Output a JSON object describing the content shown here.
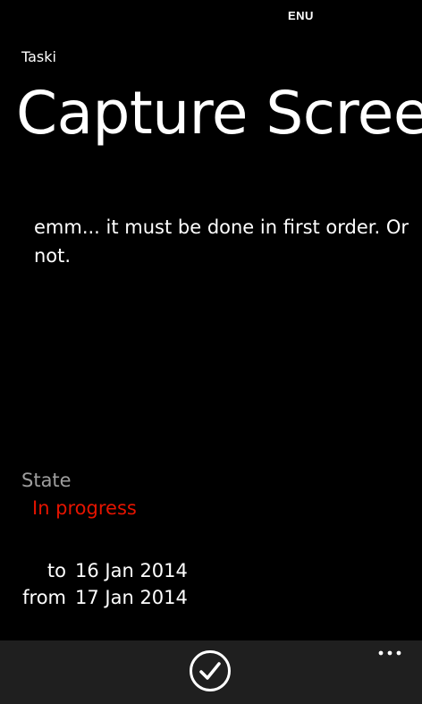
{
  "status_bar": {
    "language": "ENU"
  },
  "app": {
    "name": "Taski"
  },
  "task": {
    "title": "Capture Screen",
    "description": "emm... it must be done in first order. Or not.",
    "state_label": "State",
    "state_value": "In progress",
    "dates": {
      "to_label": "to",
      "to_value": "16 Jan 2014",
      "from_label": "from",
      "from_value": "17 Jan 2014"
    }
  },
  "app_bar": {
    "buttons": [
      {
        "icon": "check-icon"
      },
      {
        "icon": "more-icon"
      }
    ]
  },
  "colors": {
    "background": "#000000",
    "accent_state": "#e51400",
    "label_gray": "#9e9e9e",
    "app_bar": "#1f1f1f"
  }
}
